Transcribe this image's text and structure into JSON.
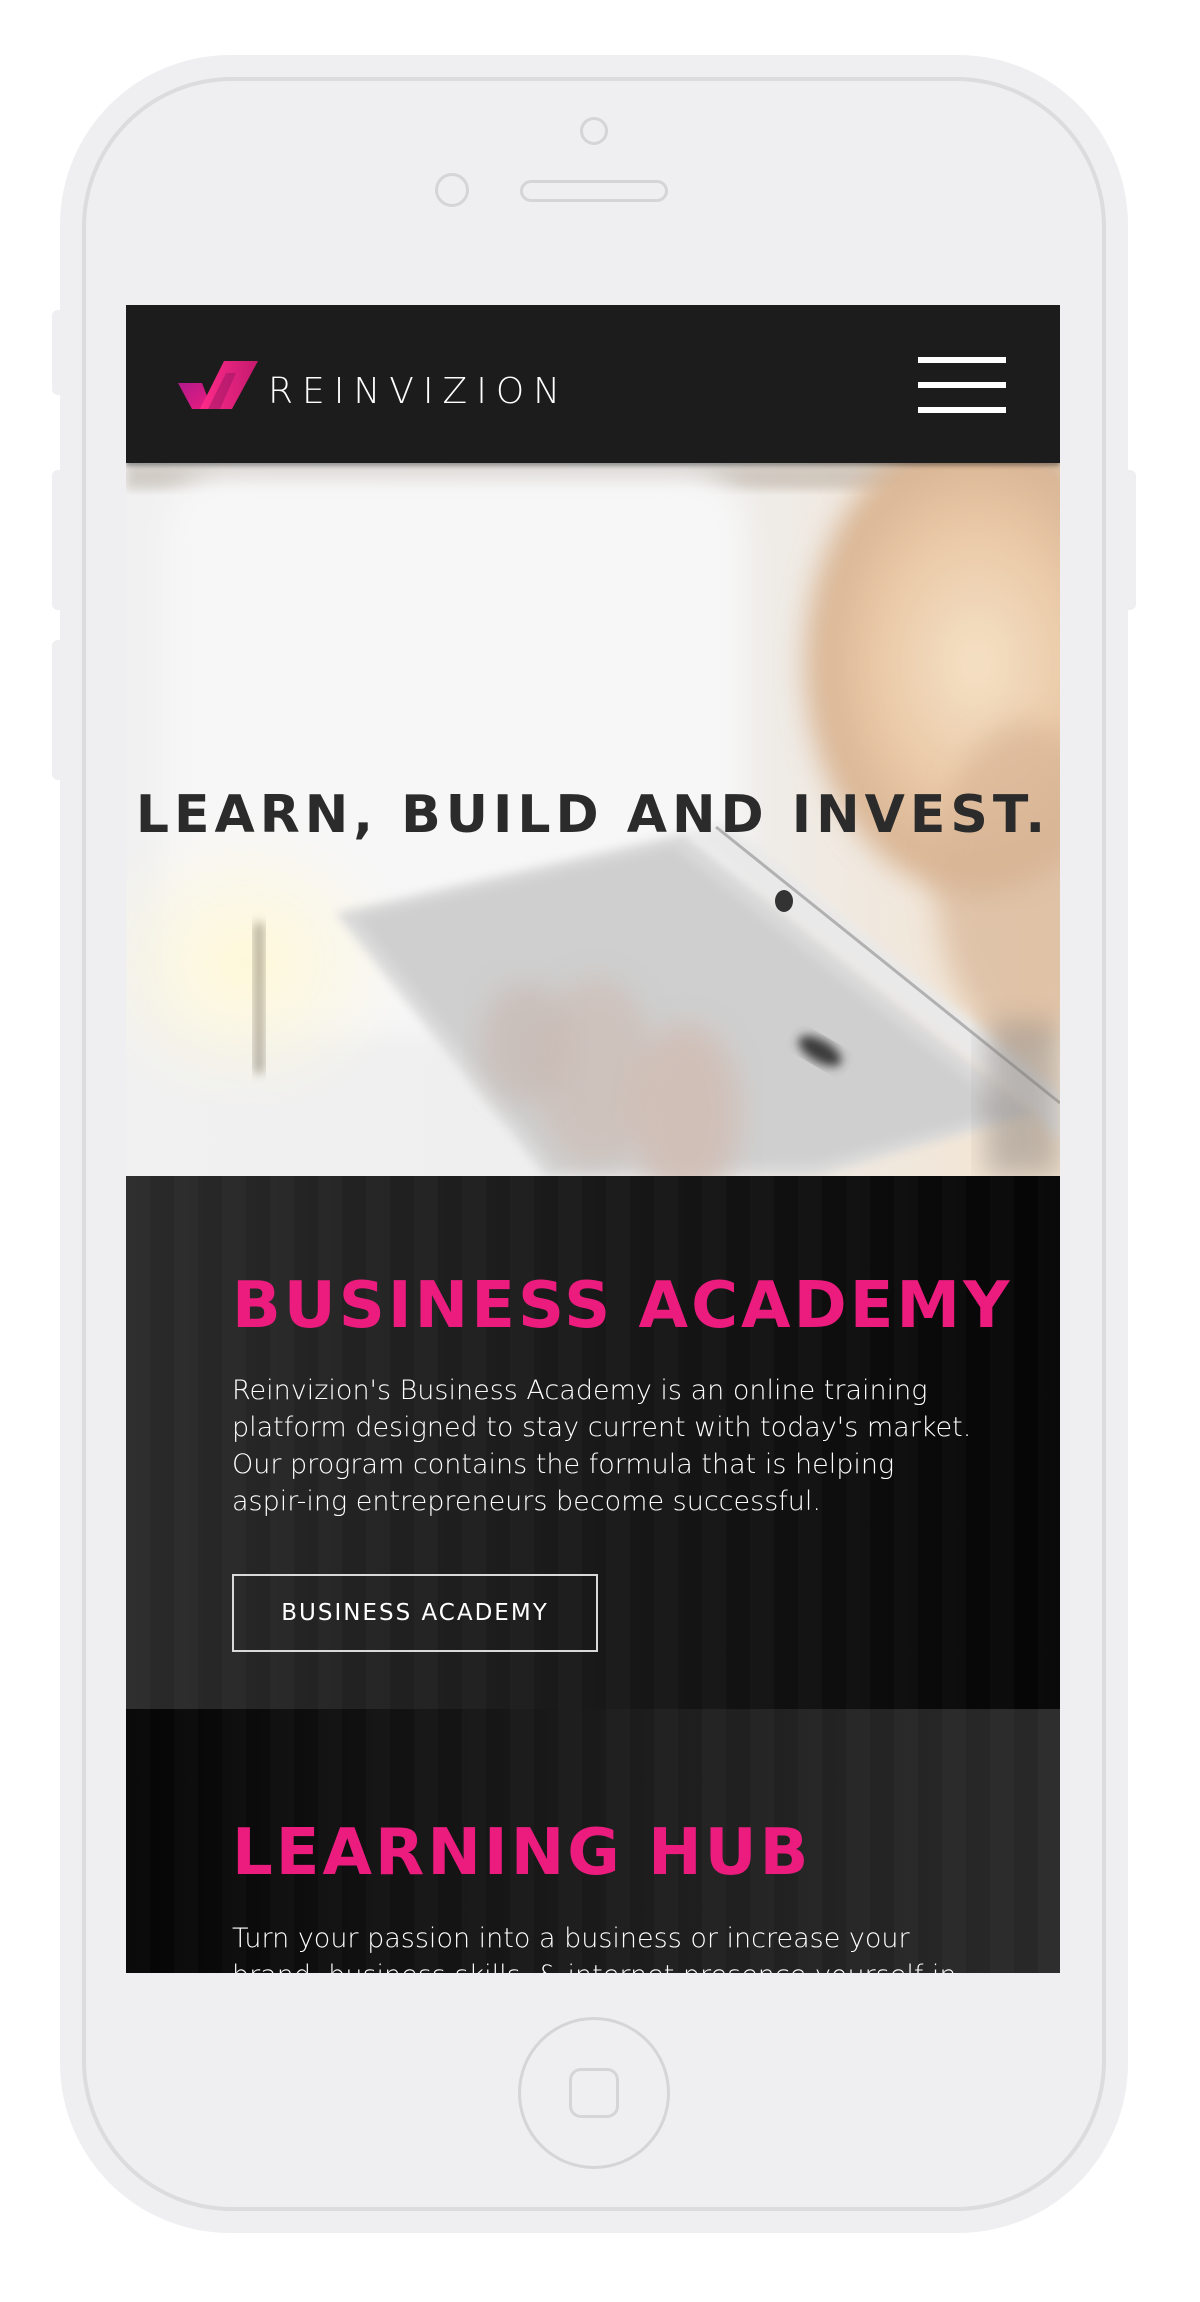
{
  "brand": {
    "name": "REINVIZION",
    "accent_color": "#ec1c7f",
    "logo_icon": "reinvizion-logo-mark"
  },
  "header": {
    "menu_icon": "hamburger-menu-icon"
  },
  "hero": {
    "title": "LEARN, BUILD AND INVEST."
  },
  "sections": {
    "academy": {
      "title": "BUSINESS ACADEMY",
      "text": "Reinvizion's Business Academy is an online training platform designed to stay current with today's market. Our program contains the formula that is helping aspir-ing entrepreneurs become successful.",
      "button_label": "BUSINESS ACADEMY"
    },
    "hub": {
      "title": "LEARNING HUB",
      "text": "Turn your passion into a business or increase your brand,  business skills, & internet presence yourself in"
    }
  }
}
